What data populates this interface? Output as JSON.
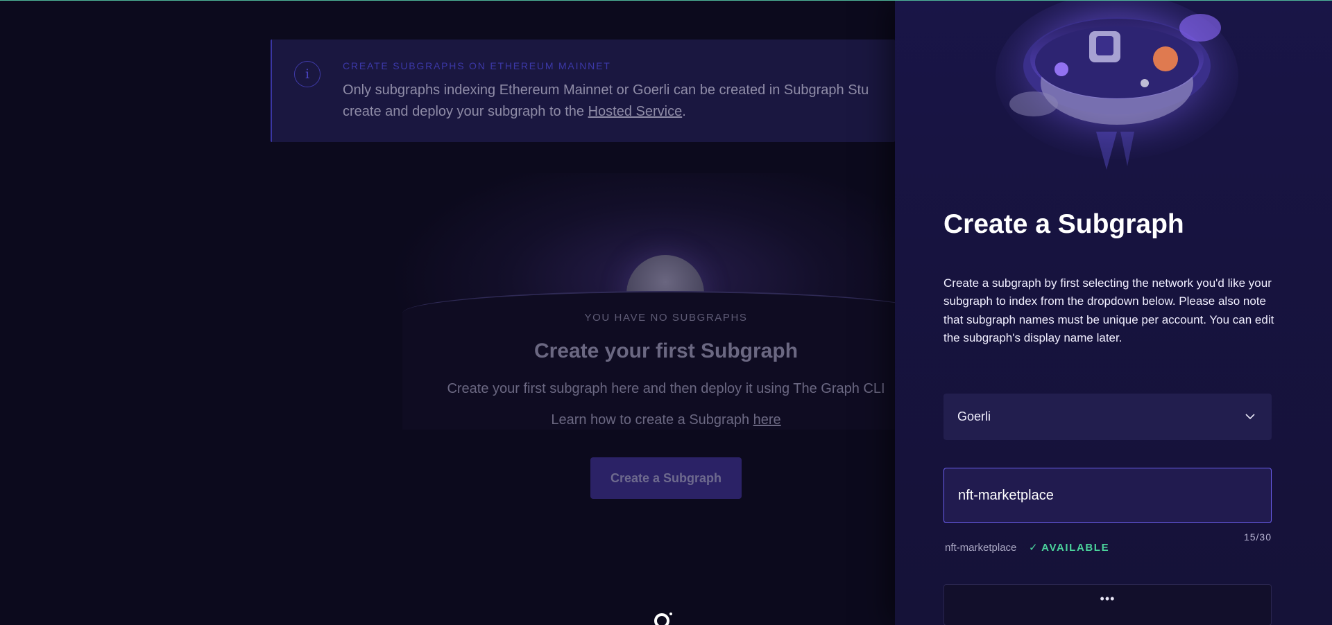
{
  "banner": {
    "title": "CREATE SUBGRAPHS ON ETHEREUM MAINNET",
    "text_line1": "Only subgraphs indexing Ethereum Mainnet or Goerli can be created in Subgraph Stu",
    "text_line2_prefix": "create and deploy your subgraph to the ",
    "link_label": "Hosted Service",
    "text_line2_suffix": ".",
    "icon": "info-icon"
  },
  "empty_state": {
    "label": "YOU HAVE NO SUBGRAPHS",
    "title": "Create your first Subgraph",
    "subtitle": "Create your first subgraph here and then deploy it using The Graph CLI",
    "learn_prefix": "Learn how to create a Subgraph ",
    "learn_link": "here",
    "button_label": "Create a Subgraph"
  },
  "drawer": {
    "title": "Create a Subgraph",
    "description": "Create a subgraph by first selecting the network you'd like your subgraph to index from the dropdown below. Please also note that subgraph names must be unique per account. You can edit the subgraph's display name later.",
    "network": {
      "selected": "Goerli",
      "icon": "chevron-down-icon"
    },
    "name_input": {
      "value": "nft-marketplace"
    },
    "counter": "15/30",
    "name_echo": "nft-marketplace",
    "availability": "AVAILABLE",
    "availability_color": "#4bd39c",
    "submit_label": "•••"
  },
  "colors": {
    "accent": "#6c5ff0",
    "background": "#0c0a1d",
    "drawer": "#191547"
  }
}
